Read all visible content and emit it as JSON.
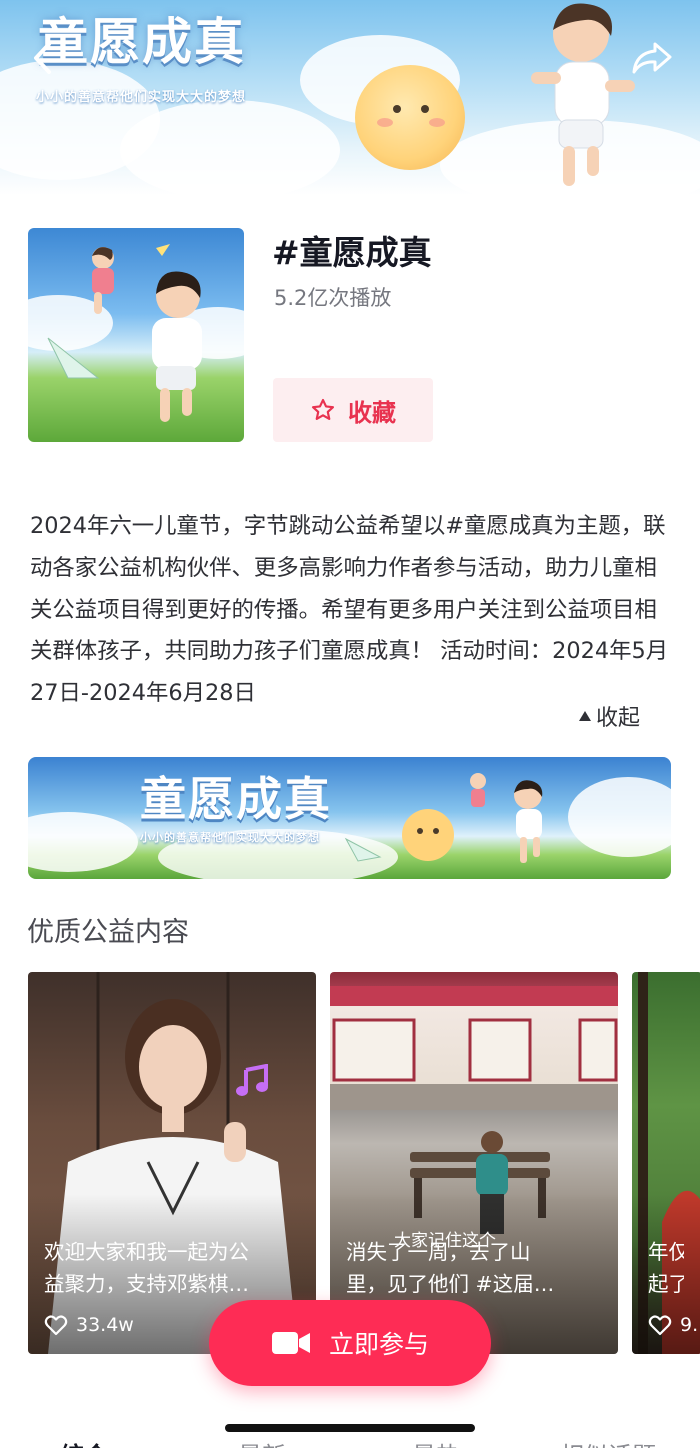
{
  "header": {
    "title": "童愿成真",
    "subtitle": "小小的善意帮他们实现大大的梦想",
    "back_icon": "chevron-left-icon",
    "share_icon": "share-arrow-icon"
  },
  "topic": {
    "title": "#童愿成真",
    "play_count": "5.2亿次播放",
    "favorite_label": "收藏",
    "favorite_icon": "star-outline-icon",
    "description": "2024年六一儿童节，字节跳动公益希望以#童愿成真为主题，联动各家公益机构伙伴、更多高影响力作者参与活动，助力儿童相关公益项目得到更好的传播。希望有更多用户关注到公益项目相关群体孩子，共同助力孩子们童愿成真！ 活动时间：2024年5月27日-2024年6月28日",
    "collapse_label": "收起"
  },
  "banner": {
    "title": "童愿成真",
    "subtitle": "小小的善意帮他们实现大大的梦想"
  },
  "section": {
    "title": "优质公益内容"
  },
  "videos": [
    {
      "caption_line1": "欢迎大家和我一起为公",
      "caption_line2": "益聚力，支持邓紫棋…",
      "likes": "33.4w"
    },
    {
      "caption_line1": "消失了一周，去了山",
      "caption_line2": "里，见了他们 #这届…",
      "overlay_text": "大家记住这个",
      "likes": ""
    },
    {
      "caption_line1": "年仅",
      "caption_line2": "起了",
      "likes": "9."
    }
  ],
  "cta": {
    "label": "立即参与",
    "icon": "video-camera-icon"
  },
  "tabs": [
    "综合",
    "最新",
    "最热",
    "相似话题"
  ],
  "colors": {
    "accent": "#fe2c55",
    "favorite_bg": "#fdeef0",
    "favorite_text": "#e8324f"
  }
}
